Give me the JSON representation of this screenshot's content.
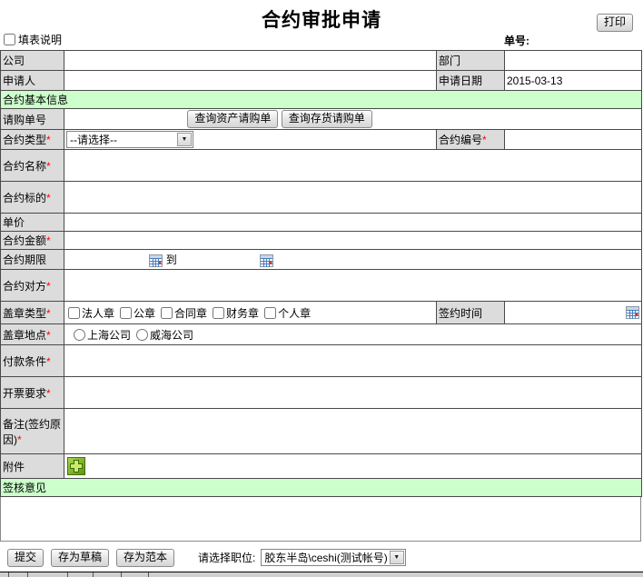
{
  "colors": {
    "section_green": "#ccffcc",
    "label_gray": "#dcdcdc",
    "required_red": "#ff0000",
    "attach_green": "#5d9413"
  },
  "misc": {
    "required_mark": "*",
    "dropdown_arrow": "▼"
  },
  "header": {
    "title": "合约审批申请",
    "print_button": "打印",
    "form_note": "填表说明",
    "order_no": "单号:"
  },
  "form": {
    "company_label": "公司",
    "department_label": "部门",
    "applicant_label": "申请人",
    "apply_date_label": "申请日期",
    "apply_date_value": "2015-03-13",
    "section_basic_info": "合约基本信息",
    "requisition_no_label": "请购单号",
    "query_asset_button": "查询资产请购单",
    "query_stock_button": "查询存货请购单",
    "contract_type_label": "合约类型",
    "contract_type_value": "--请选择--",
    "contract_no_label": "合约编号",
    "contract_name_label": "合约名称",
    "contract_subject_label": "合约标的",
    "unit_price_label": "单价",
    "contract_amount_label": "合约金额",
    "contract_period_label": "合约期限",
    "period_to_text": "到",
    "counterparty_label": "合约对方",
    "seal_type_label": "盖章类型",
    "seal_type_options": [
      "法人章",
      "公章",
      "合同章",
      "财务章",
      "个人章"
    ],
    "sign_time_label": "签约时间",
    "seal_place_label": "盖章地点",
    "seal_place_options": [
      "上海公司",
      "威海公司"
    ],
    "payment_terms_label": "付款条件",
    "invoice_req_label": "开票要求",
    "remarks_label": "备注(签约原因)",
    "attachment_label": "附件",
    "section_approval": "签核意见"
  },
  "footer": {
    "submit_button": "提交",
    "save_draft_button": "存为草稿",
    "save_template_button": "存为范本",
    "position_label": "请选择职位:",
    "position_value": "胶东半岛\\ceshi(测试帐号)"
  }
}
